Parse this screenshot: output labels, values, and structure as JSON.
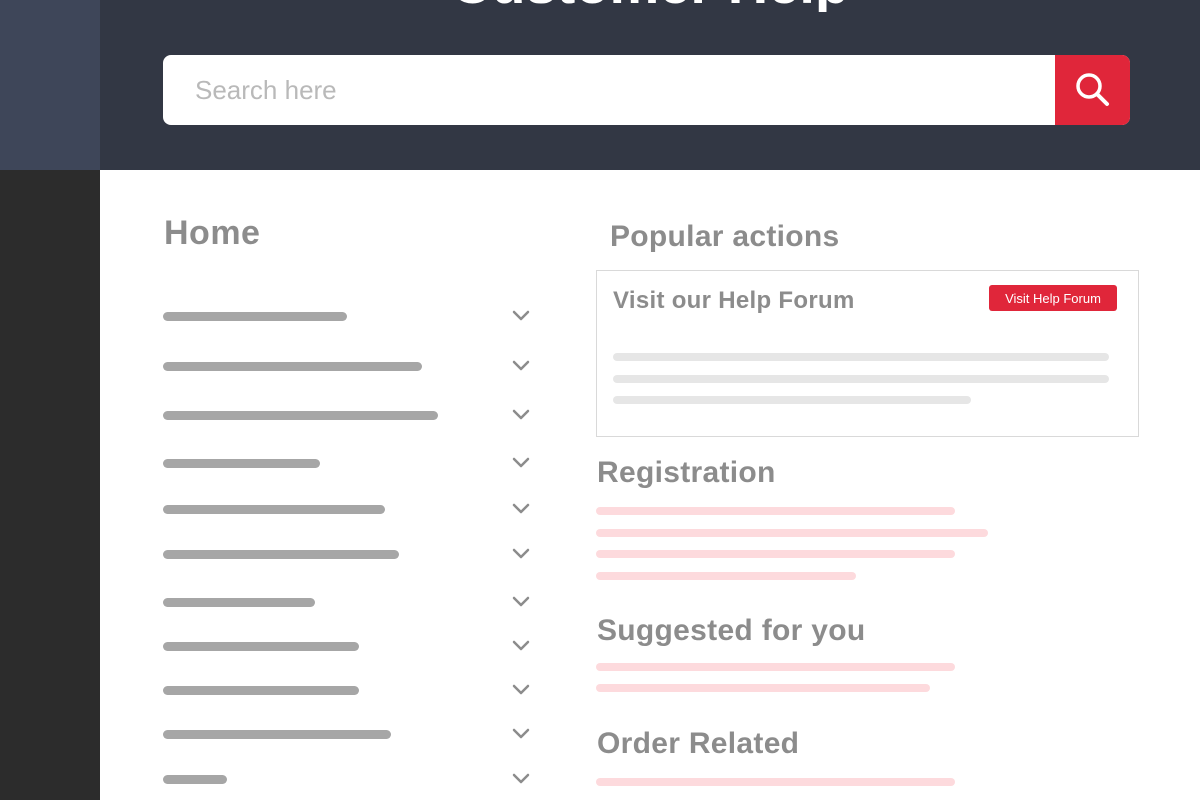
{
  "header": {
    "title": "Customer Help"
  },
  "search": {
    "placeholder": "Search here",
    "value": "",
    "button_icon": "search-icon"
  },
  "nav": {
    "title": "Home",
    "items_icon": "chevron-down-icon",
    "item_count": 11
  },
  "popular": {
    "title": "Popular actions",
    "card_title": "Visit our Help Forum",
    "button_label": "Visit Help Forum"
  },
  "sections": {
    "registration": "Registration",
    "suggested": "Suggested for you",
    "order": "Order Related"
  },
  "colors": {
    "accent": "#e0263a",
    "header_bg": "#323744",
    "text_muted": "#8c8c8c",
    "placeholder_line": "#a6a6a6",
    "pink_line": "#fddadd"
  }
}
